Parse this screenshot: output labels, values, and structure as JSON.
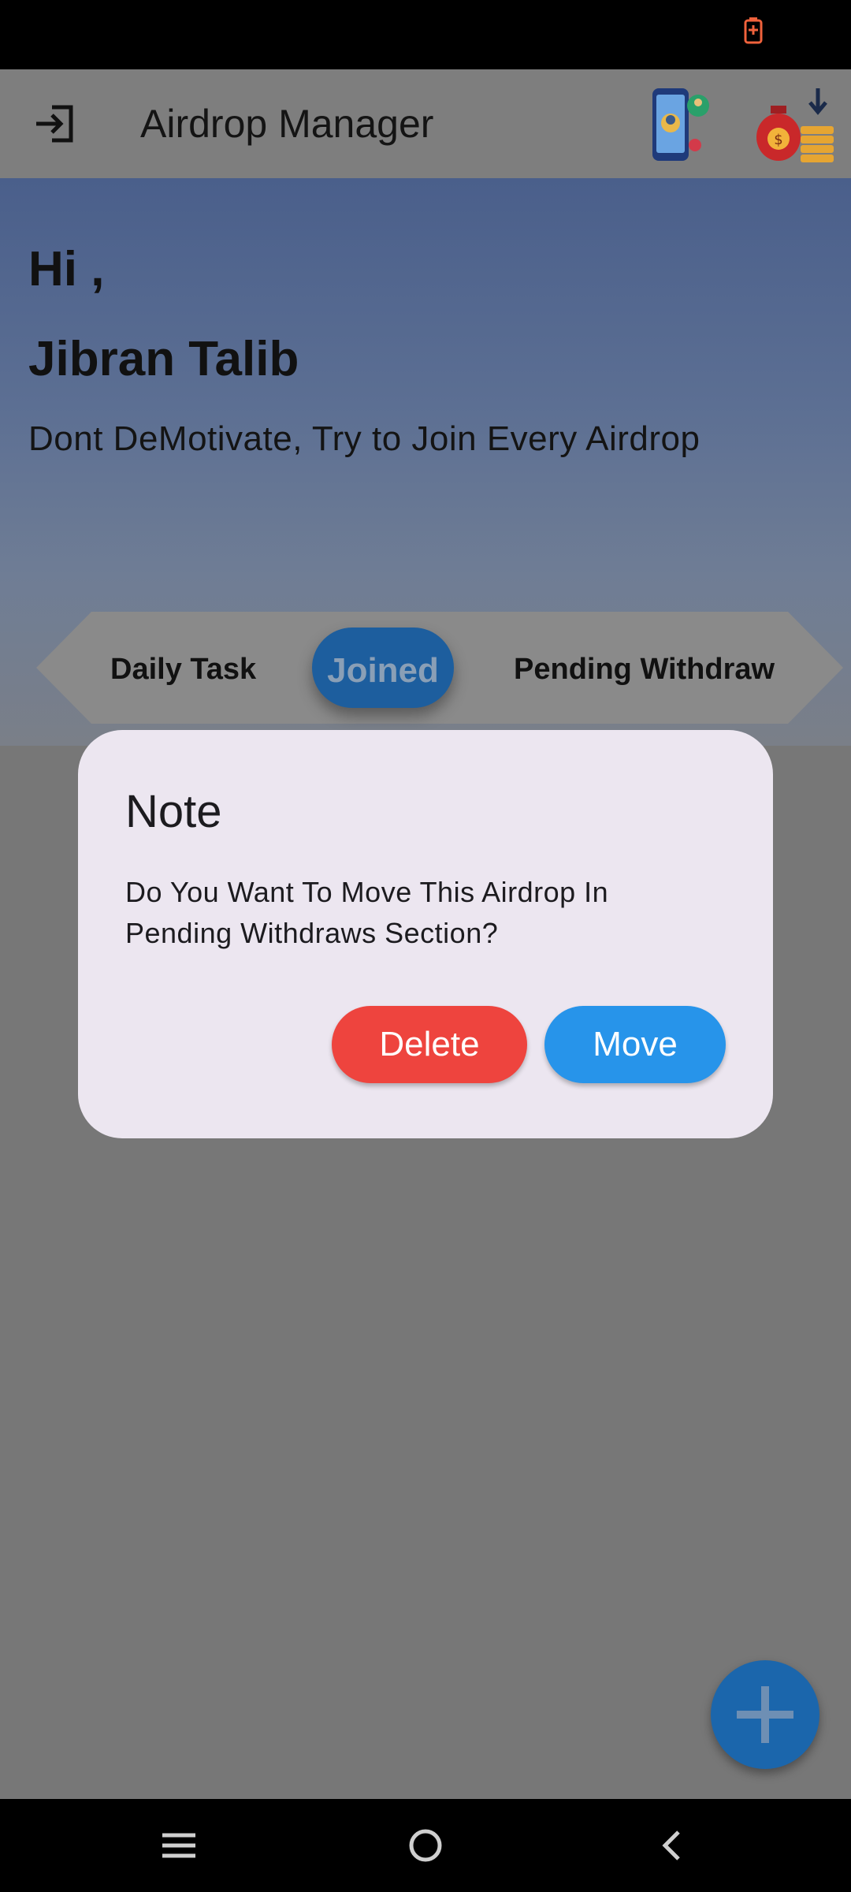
{
  "app_bar": {
    "title": "Airdrop Manager"
  },
  "header": {
    "greeting": "Hi ,",
    "user_name": "Jibran Talib",
    "motivation": "Dont DeMotivate, Try to Join Every Airdrop"
  },
  "tabs": [
    {
      "label": "Daily Task",
      "selected": false
    },
    {
      "label": "Joined",
      "selected": true
    },
    {
      "label": "Pending Withdraw",
      "selected": false
    }
  ],
  "dialog": {
    "title": "Note",
    "message": "Do You Want To Move This Airdrop In Pending Withdraws Section?",
    "delete_label": "Delete",
    "move_label": "Move"
  },
  "colors": {
    "delete_button": "#ee443e",
    "move_button": "#2794ea",
    "selected_tab": "#1d5e9e",
    "fab": "#1b66ac",
    "dialog_bg": "#ece6f0"
  },
  "icons": {
    "status": "battery-charging-icon",
    "app_bar_leading": "logout-icon",
    "app_bar_actions": [
      "phone-user-icon",
      "money-bag-icon"
    ],
    "fab": "plus-icon",
    "nav": [
      "menu-icon",
      "home-icon",
      "back-icon"
    ]
  }
}
